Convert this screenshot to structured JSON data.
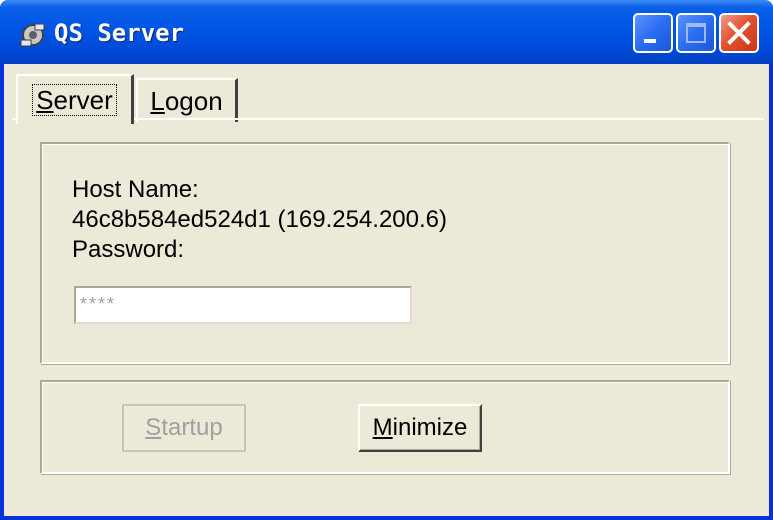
{
  "window": {
    "title": "QS Server",
    "controls": {
      "minimize": "minimize-icon",
      "maximize": "maximize-icon",
      "close": "close-icon"
    }
  },
  "tabs": [
    {
      "label": "Server",
      "mnemonic": "S",
      "rest": "erver",
      "active": true
    },
    {
      "label": "Logon",
      "mnemonic": "L",
      "rest": "ogon",
      "active": false
    }
  ],
  "server": {
    "host_label": "Host Name:",
    "host_value": "46c8b584ed524d1  (169.254.200.6)",
    "password_label": "Password:",
    "password_value": "****"
  },
  "buttons": {
    "startup": {
      "mnemonic": "S",
      "rest": "tartup",
      "enabled": false
    },
    "minimize": {
      "mnemonic": "M",
      "rest": "inimize",
      "enabled": true
    }
  },
  "colors": {
    "titlebar": "#0055e5",
    "frame": "#0831d9",
    "face": "#ece9d8",
    "close": "#e2522f"
  }
}
